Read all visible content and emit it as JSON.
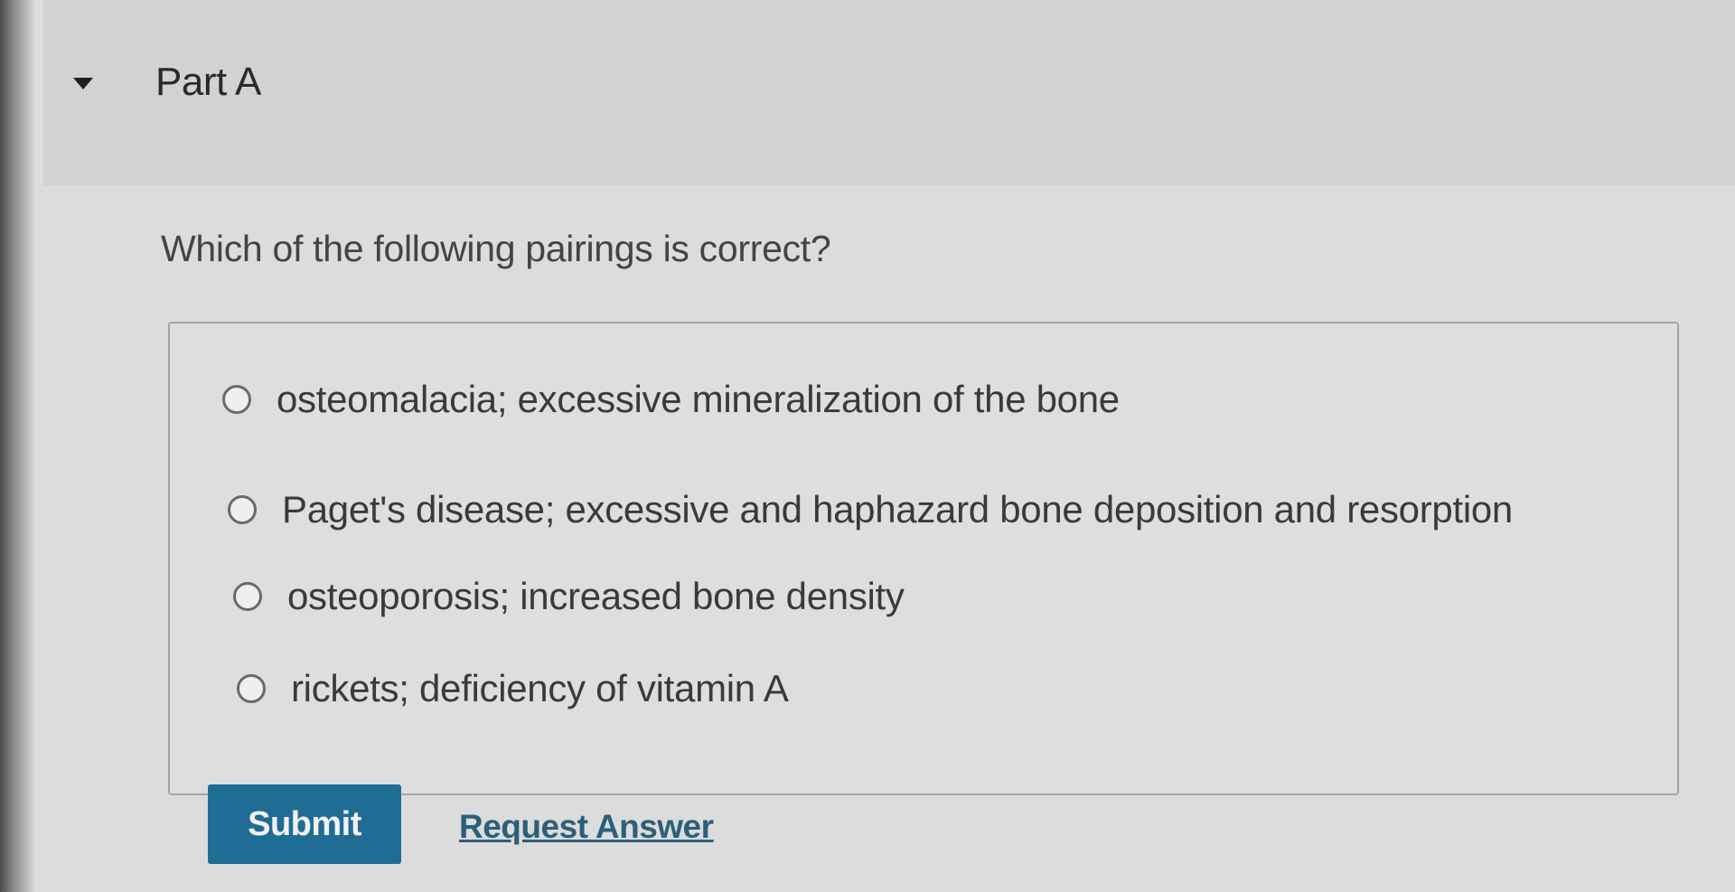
{
  "part": {
    "title": "Part A",
    "toggle_icon": "caret-down-icon"
  },
  "question": {
    "text": "Which of the following pairings is correct?"
  },
  "options": [
    {
      "label": "osteomalacia; excessive mineralization of the bone",
      "selected": false
    },
    {
      "label": "Paget's disease; excessive and haphazard bone deposition and resorption",
      "selected": false
    },
    {
      "label": "osteoporosis; increased bone density",
      "selected": false
    },
    {
      "label": "rickets; deficiency of vitamin A",
      "selected": false
    }
  ],
  "actions": {
    "submit_label": "Submit",
    "request_answer_label": "Request Answer"
  },
  "colors": {
    "accent": "#1f6d95",
    "link": "#2c5f7a"
  }
}
